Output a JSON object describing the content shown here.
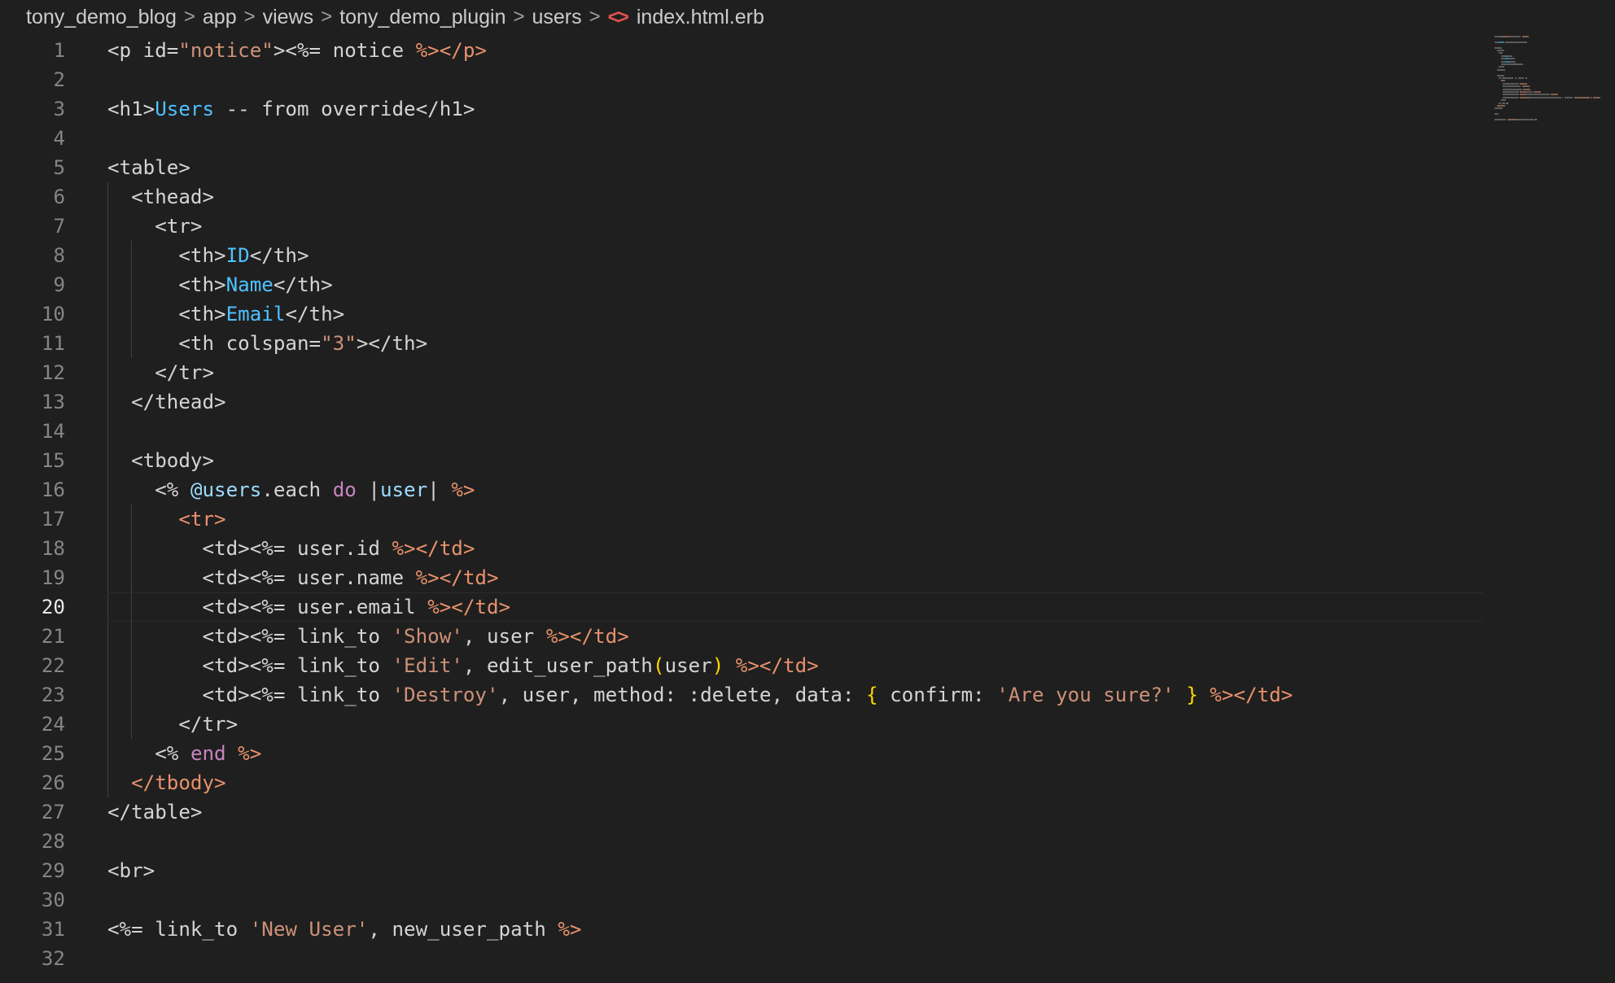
{
  "breadcrumb": {
    "items": [
      "tony_demo_blog",
      "app",
      "views",
      "tony_demo_plugin",
      "users"
    ],
    "file_icon": "code-file-icon",
    "file_name": "index.html.erb",
    "separator": ">"
  },
  "editor": {
    "active_line": 20,
    "line_numbers": [
      "1",
      "2",
      "3",
      "4",
      "5",
      "6",
      "7",
      "8",
      "9",
      "10",
      "11",
      "12",
      "13",
      "14",
      "15",
      "16",
      "17",
      "18",
      "19",
      "20",
      "21",
      "22",
      "23",
      "24",
      "25",
      "26",
      "27",
      "28",
      "29",
      "30",
      "31",
      "32"
    ],
    "lines": [
      [
        {
          "t": "<p id=",
          "c": "tag"
        },
        {
          "t": "\"notice\"",
          "c": "str"
        },
        {
          "t": "><%= notice ",
          "c": "tag"
        },
        {
          "t": "%></p>",
          "c": "erb"
        }
      ],
      [],
      [
        {
          "t": "<h1>",
          "c": "tag"
        },
        {
          "t": "Users",
          "c": "blue"
        },
        {
          "t": " -- from override</h1>",
          "c": "tag"
        }
      ],
      [],
      [
        {
          "t": "<table>",
          "c": "tag"
        }
      ],
      [
        {
          "t": "  <thead>",
          "c": "tag"
        }
      ],
      [
        {
          "t": "    <tr>",
          "c": "tag"
        }
      ],
      [
        {
          "t": "      <th>",
          "c": "tag"
        },
        {
          "t": "ID",
          "c": "blue"
        },
        {
          "t": "</th>",
          "c": "tag"
        }
      ],
      [
        {
          "t": "      <th>",
          "c": "tag"
        },
        {
          "t": "Name",
          "c": "blue"
        },
        {
          "t": "</th>",
          "c": "tag"
        }
      ],
      [
        {
          "t": "      <th>",
          "c": "tag"
        },
        {
          "t": "Email",
          "c": "blue"
        },
        {
          "t": "</th>",
          "c": "tag"
        }
      ],
      [
        {
          "t": "      <th colspan=",
          "c": "tag"
        },
        {
          "t": "\"3\"",
          "c": "str"
        },
        {
          "t": "></th>",
          "c": "tag"
        }
      ],
      [
        {
          "t": "    </tr>",
          "c": "tag"
        }
      ],
      [
        {
          "t": "  </thead>",
          "c": "tag"
        }
      ],
      [],
      [
        {
          "t": "  <tbody>",
          "c": "tag"
        }
      ],
      [
        {
          "t": "    <% ",
          "c": "tag"
        },
        {
          "t": "@users",
          "c": "ivar"
        },
        {
          "t": ".each ",
          "c": "tag"
        },
        {
          "t": "do",
          "c": "kw"
        },
        {
          "t": " |",
          "c": "tag"
        },
        {
          "t": "user",
          "c": "ivar"
        },
        {
          "t": "| ",
          "c": "tag"
        },
        {
          "t": "%>",
          "c": "erb"
        }
      ],
      [
        {
          "t": "      <tr>",
          "c": "erb"
        }
      ],
      [
        {
          "t": "        <td><%= user.id ",
          "c": "tag"
        },
        {
          "t": "%></td>",
          "c": "erb"
        }
      ],
      [
        {
          "t": "        <td><%= user.name ",
          "c": "tag"
        },
        {
          "t": "%></td>",
          "c": "erb"
        }
      ],
      [
        {
          "t": "        <td><%= user.email ",
          "c": "tag"
        },
        {
          "t": "%></td>",
          "c": "erb"
        }
      ],
      [
        {
          "t": "        <td><%= link_to ",
          "c": "tag"
        },
        {
          "t": "'Show'",
          "c": "str"
        },
        {
          "t": ", user ",
          "c": "tag"
        },
        {
          "t": "%></td>",
          "c": "erb"
        }
      ],
      [
        {
          "t": "        <td><%= link_to ",
          "c": "tag"
        },
        {
          "t": "'Edit'",
          "c": "str"
        },
        {
          "t": ", edit_user_path",
          "c": "tag"
        },
        {
          "t": "(",
          "c": "brace"
        },
        {
          "t": "user",
          "c": "tag"
        },
        {
          "t": ")",
          "c": "brace"
        },
        {
          "t": " %></td>",
          "c": "erb"
        }
      ],
      [
        {
          "t": "        <td><%= link_to ",
          "c": "tag"
        },
        {
          "t": "'Destroy'",
          "c": "str"
        },
        {
          "t": ", user, method: :delete, data: ",
          "c": "tag"
        },
        {
          "t": "{",
          "c": "brace"
        },
        {
          "t": " confirm: ",
          "c": "tag"
        },
        {
          "t": "'Are you sure?'",
          "c": "str"
        },
        {
          "t": " ",
          "c": "tag"
        },
        {
          "t": "}",
          "c": "brace"
        },
        {
          "t": " %></td>",
          "c": "erb"
        }
      ],
      [
        {
          "t": "      </tr>",
          "c": "tag"
        }
      ],
      [
        {
          "t": "    <% ",
          "c": "tag"
        },
        {
          "t": "end",
          "c": "kw"
        },
        {
          "t": " %>",
          "c": "erb"
        }
      ],
      [
        {
          "t": "  </tbody>",
          "c": "erb"
        }
      ],
      [
        {
          "t": "</table>",
          "c": "tag"
        }
      ],
      [],
      [
        {
          "t": "<br>",
          "c": "tag"
        }
      ],
      [],
      [
        {
          "t": "<%= link_to ",
          "c": "tag"
        },
        {
          "t": "'New User'",
          "c": "str"
        },
        {
          "t": ", new_user_path ",
          "c": "tag"
        },
        {
          "t": "%>",
          "c": "erb"
        }
      ],
      []
    ]
  },
  "colors": {
    "background": "#1f1f1f",
    "text": "#d4d4d4",
    "string": "#ce9178",
    "erb_delimiter": "#e8916b",
    "identifier_blue": "#4fc1ff",
    "keyword": "#c586c0",
    "variable": "#9cdcfe",
    "bracket": "#ffd700",
    "line_number": "#858585",
    "file_icon": "#e0534f"
  }
}
